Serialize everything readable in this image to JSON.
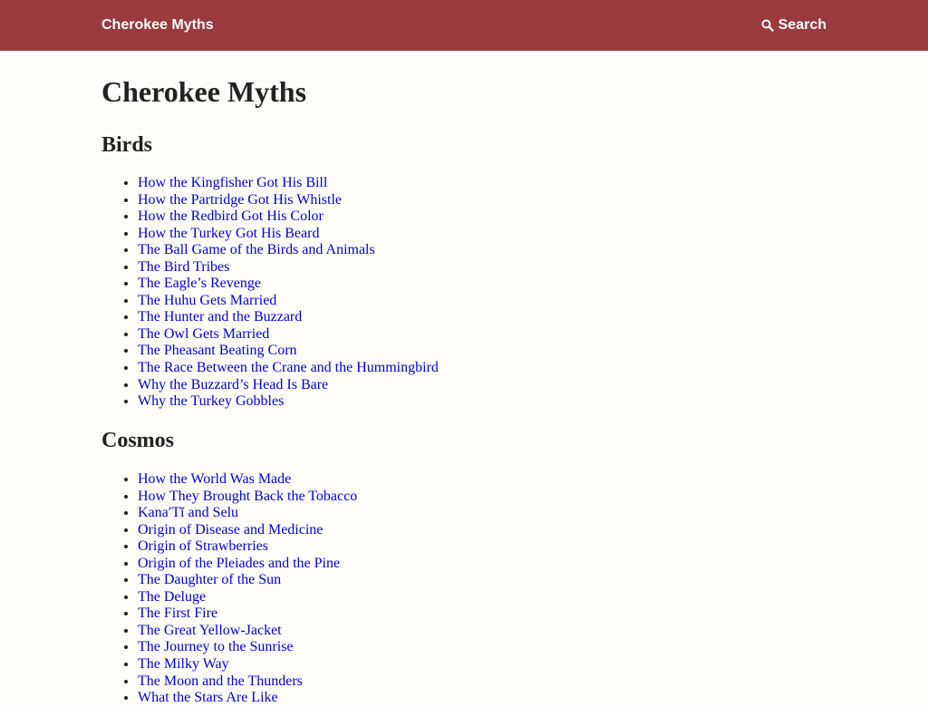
{
  "header": {
    "site_title": "Cherokee Myths",
    "search_label": "Search",
    "search_icon": "search-icon"
  },
  "page": {
    "title": "Cherokee Myths"
  },
  "sections": [
    {
      "title": "Birds",
      "items": [
        "How the Kingfisher Got His Bill",
        "How the Partridge Got His Whistle",
        "How the Redbird Got His Color",
        "How the Turkey Got His Beard",
        "The Ball Game of the Birds and Animals",
        "The Bird Tribes",
        "The Eagle’s Revenge",
        "The Huhu Gets Married",
        "The Hunter and the Buzzard",
        "The Owl Gets Married",
        "The Pheasant Beating Corn",
        "The Race Between the Crane and the Hummingbird",
        "Why the Buzzard’s Head Is Bare",
        "Why the Turkey Gobbles"
      ]
    },
    {
      "title": "Cosmos",
      "items": [
        "How the World Was Made",
        "How They Brought Back the Tobacco",
        "Kana′Tĭ and Selu",
        "Origin of Disease and Medicine",
        "Origin of Strawberries",
        "Origin of the Pleiades and the Pine",
        "The Daughter of the Sun",
        "The Deluge",
        "The First Fire",
        "The Great Yellow-Jacket",
        "The Journey to the Sunrise",
        "The Milky Way",
        "The Moon and the Thunders",
        "What the Stars Are Like"
      ]
    }
  ]
}
